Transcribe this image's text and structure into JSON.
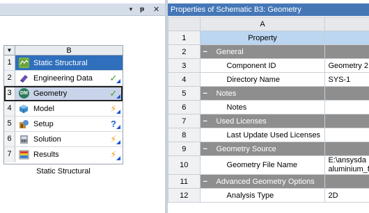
{
  "left_pane": {
    "header_controls": [
      "▼",
      "ᵽ",
      "✕"
    ],
    "system": {
      "column_letter": "B",
      "caption": "Static Structural",
      "rows": [
        {
          "num": "1",
          "label": "Static Structural",
          "icon": "static-structural-icon",
          "status": "",
          "status_icon": ""
        },
        {
          "num": "2",
          "label": "Engineering Data",
          "icon": "engineering-data-icon",
          "status": "✓",
          "status_icon": "check-icon"
        },
        {
          "num": "3",
          "label": "Geometry",
          "icon": "geometry-icon",
          "status": "✓",
          "status_icon": "check-icon"
        },
        {
          "num": "4",
          "label": "Model",
          "icon": "model-icon",
          "status": "⚡",
          "status_icon": "refresh-required-icon"
        },
        {
          "num": "5",
          "label": "Setup",
          "icon": "setup-icon",
          "status": "?",
          "status_icon": "attention-required-icon"
        },
        {
          "num": "6",
          "label": "Solution",
          "icon": "solution-icon",
          "status": "⚡",
          "status_icon": "refresh-required-icon"
        },
        {
          "num": "7",
          "label": "Results",
          "icon": "results-icon",
          "status": "⚡",
          "status_icon": "refresh-required-icon"
        }
      ]
    }
  },
  "properties": {
    "title": "Properties of Schematic B3: Geometry",
    "column_header": "A",
    "property_header": "Property",
    "rows": [
      {
        "num": "2",
        "type": "section",
        "label": "General",
        "toggle": "−",
        "value": ""
      },
      {
        "num": "3",
        "type": "item",
        "label": "Component ID",
        "value": "Geometry 2"
      },
      {
        "num": "4",
        "type": "item",
        "label": "Directory Name",
        "value": "SYS-1"
      },
      {
        "num": "5",
        "type": "section",
        "label": "Notes",
        "toggle": "−",
        "value": ""
      },
      {
        "num": "6",
        "type": "item",
        "label": "Notes",
        "value": ""
      },
      {
        "num": "7",
        "type": "section",
        "label": "Used Licenses",
        "toggle": "−",
        "value": ""
      },
      {
        "num": "8",
        "type": "item",
        "label": "Last Update Used Licenses",
        "value": ""
      },
      {
        "num": "9",
        "type": "section",
        "label": "Geometry Source",
        "toggle": "−",
        "value": ""
      },
      {
        "num": "10",
        "type": "item",
        "label": "Geometry File Name",
        "value": "E:\\ansysda aluminium_f"
      },
      {
        "num": "11",
        "type": "section",
        "label": "Advanced Geometry Options",
        "toggle": "−",
        "value": ""
      },
      {
        "num": "12",
        "type": "item",
        "label": "Analysis Type",
        "value": "2D"
      }
    ]
  },
  "colors": {
    "title_row": "#2f6fbc",
    "selected_row": "#c9d4ea",
    "section_row": "#8e8e8e",
    "property_header": "#bcd5f0",
    "panel_header": "#4577b7"
  }
}
